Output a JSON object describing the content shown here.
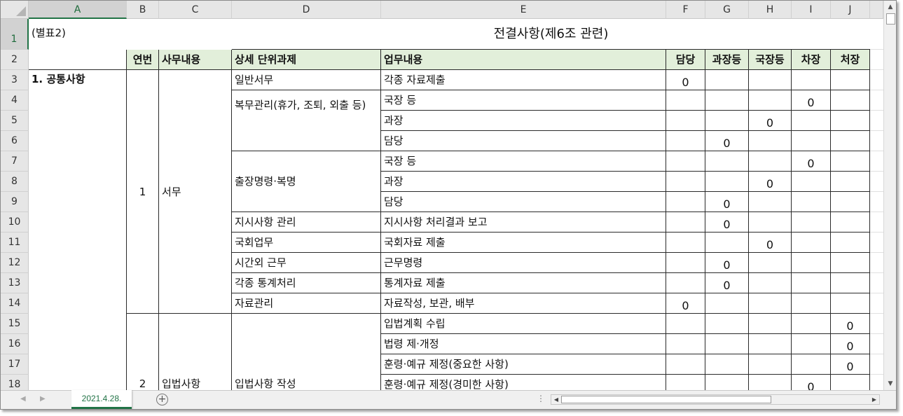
{
  "columns": [
    "A",
    "B",
    "C",
    "D",
    "E",
    "F",
    "G",
    "H",
    "I",
    "J"
  ],
  "rows": [
    "1",
    "2",
    "3",
    "4",
    "5",
    "6",
    "7",
    "8",
    "9",
    "10",
    "11",
    "12",
    "13",
    "14",
    "15",
    "16",
    "17",
    "18"
  ],
  "title_cell": "(별표2)",
  "title": "전결사항(제6조 관련)",
  "headers": {
    "seq": "연번",
    "task": "사무내용",
    "detail": "상세 단위과제",
    "content": "업무내용",
    "levels": [
      "담당",
      "과장등",
      "국장등",
      "차장",
      "처장"
    ]
  },
  "section": "1. 공통사항",
  "groups": [
    {
      "seq": "1",
      "task": "서무"
    },
    {
      "seq": "2",
      "task": "입법사항"
    }
  ],
  "details": [
    "일반서무",
    "복무관리(휴가, 조퇴, 외출 등)",
    "출장명령·복명",
    "지시사항 관리",
    "국회업무",
    "시간외 근무",
    "각종 통계처리",
    "자료관리",
    "입법사항 작성"
  ],
  "contents": [
    "각종 자료제출",
    "국장 등",
    "과장",
    "담당",
    "국장 등",
    "과장",
    "담당",
    "지시사항 처리결과 보고",
    "국회자료 제출",
    "근무명령",
    "통계자료 제출",
    "자료작성, 보관, 배부",
    "입법계획 수립",
    "법령 제·개정",
    "훈령·예규 제정(중요한 사항)",
    "훈령·예규 제정(경미한 사항)"
  ],
  "mark": "0",
  "sheet_tab": "2021.4.28.",
  "icons": {
    "add_sheet": "plus-circle-icon",
    "prev_sheet": "triangle-left-icon",
    "next_sheet": "triangle-right-icon",
    "scroll_up": "triangle-up-icon",
    "scroll_down": "triangle-down-icon",
    "scroll_left": "triangle-left-icon",
    "scroll_right": "triangle-right-icon",
    "options": "vertical-dots-icon"
  },
  "colors": {
    "header_fill": "#e2efda",
    "accent": "#217346"
  }
}
